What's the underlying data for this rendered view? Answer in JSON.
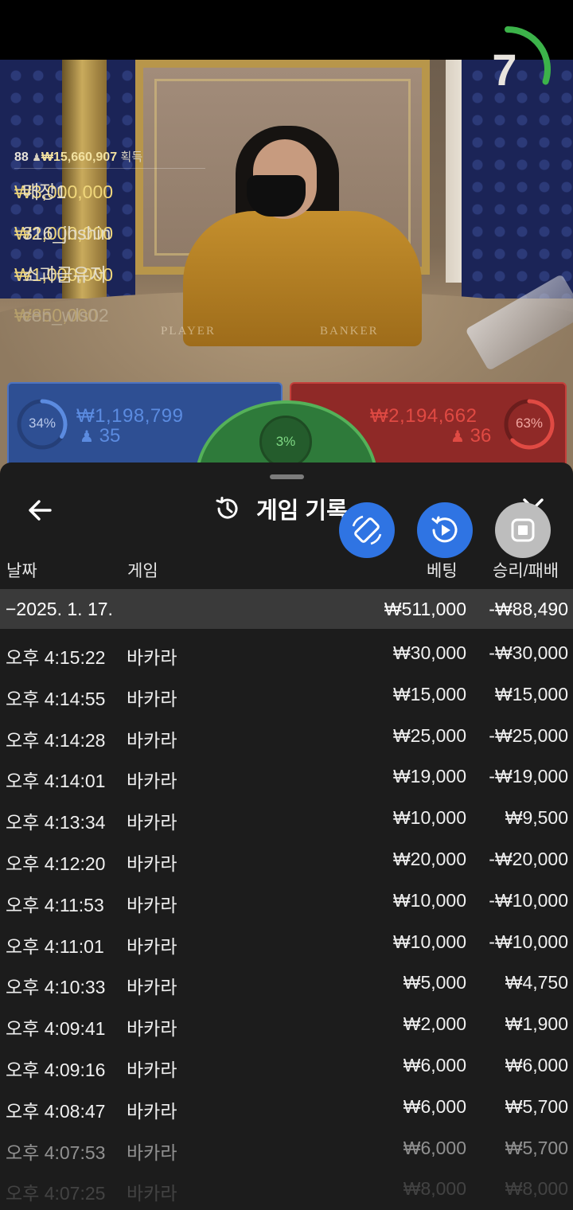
{
  "video": {
    "countdown": "7",
    "countdown_progress": 0.6,
    "table_labels": {
      "player": "PLAYER",
      "banker": "BANKER"
    },
    "winners_header": {
      "count": "88",
      "amount": "₩15,660,907",
      "label": "획득"
    },
    "winners": [
      {
        "amount": "₩3,000,000",
        "name": "매장1"
      },
      {
        "amount": "₩2,000,000",
        "name": "316_jhshin"
      },
      {
        "amount": "₩1,000,000",
        "name": "소과금유저"
      },
      {
        "amount": "₩850,000",
        "name": "cen_wls02"
      }
    ]
  },
  "bets": {
    "player": {
      "percent_text": "34%",
      "percent": 0.34,
      "amount": "₩1,198,799",
      "count": "35",
      "color": "#5b8be0"
    },
    "tie": {
      "percent_text": "3%",
      "percent": 0.03,
      "color": "#55b159"
    },
    "banker": {
      "percent_text": "63%",
      "percent": 0.63,
      "amount": "₩2,194,662",
      "count": "36",
      "color": "#e04a43"
    }
  },
  "sheet": {
    "title": "게임 기록",
    "columns": {
      "date": "날짜",
      "game": "게임",
      "bet": "베팅",
      "result": "승리/패배"
    },
    "day": {
      "date": "−2025. 1. 17.",
      "bet": "₩511,000",
      "result": "-₩88,490"
    },
    "rows": [
      {
        "time": "오후 4:15:22",
        "game": "바카라",
        "bet": "₩30,000",
        "result": "-₩30,000"
      },
      {
        "time": "오후 4:14:55",
        "game": "바카라",
        "bet": "₩15,000",
        "result": "₩15,000"
      },
      {
        "time": "오후 4:14:28",
        "game": "바카라",
        "bet": "₩25,000",
        "result": "-₩25,000"
      },
      {
        "time": "오후 4:14:01",
        "game": "바카라",
        "bet": "₩19,000",
        "result": "-₩19,000"
      },
      {
        "time": "오후 4:13:34",
        "game": "바카라",
        "bet": "₩10,000",
        "result": "₩9,500"
      },
      {
        "time": "오후 4:12:20",
        "game": "바카라",
        "bet": "₩20,000",
        "result": "-₩20,000"
      },
      {
        "time": "오후 4:11:53",
        "game": "바카라",
        "bet": "₩10,000",
        "result": "-₩10,000"
      },
      {
        "time": "오후 4:11:01",
        "game": "바카라",
        "bet": "₩10,000",
        "result": "-₩10,000"
      },
      {
        "time": "오후 4:10:33",
        "game": "바카라",
        "bet": "₩5,000",
        "result": "₩4,750"
      },
      {
        "time": "오후 4:09:41",
        "game": "바카라",
        "bet": "₩2,000",
        "result": "₩1,900"
      },
      {
        "time": "오후 4:09:16",
        "game": "바카라",
        "bet": "₩6,000",
        "result": "₩6,000"
      },
      {
        "time": "오후 4:08:47",
        "game": "바카라",
        "bet": "₩6,000",
        "result": "₩5,700"
      },
      {
        "time": "오후 4:07:53",
        "game": "바카라",
        "bet": "₩6,000",
        "result": "₩5,700"
      },
      {
        "time": "오후 4:07:25",
        "game": "바카라",
        "bet": "₩8,000",
        "result": "₩8,000"
      }
    ]
  },
  "icons": {
    "back": "arrow-left-icon",
    "history": "history-icon",
    "close": "close-icon",
    "fab1": "rotate-screen-icon",
    "fab2": "replay-video-icon",
    "fab3": "stop-icon"
  }
}
